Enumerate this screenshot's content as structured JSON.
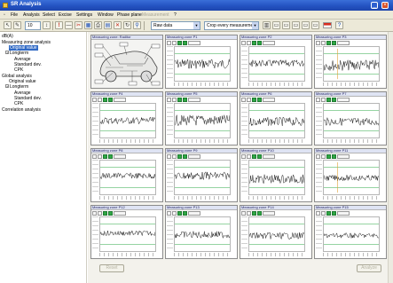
{
  "window": {
    "title": "SR Analysis"
  },
  "menu": {
    "items": [
      {
        "label": "File"
      },
      {
        "label": "Analysis"
      },
      {
        "label": "Select"
      },
      {
        "label": "Excise"
      },
      {
        "label": "Settings"
      },
      {
        "label": "Window"
      },
      {
        "label": "Phase plane"
      },
      {
        "label": "Measurement"
      },
      {
        "label": "?"
      }
    ]
  },
  "toolbar": {
    "field_value": "10",
    "data_combo": "Raw data",
    "mode_combo": "Crop every measurement"
  },
  "tree": {
    "root": "dB(A)",
    "items": [
      {
        "label": "Measuring zone analysis",
        "level": 0
      },
      {
        "label": "Original value",
        "level": 1,
        "selected": true
      },
      {
        "label": "Longterm",
        "level": 1,
        "expander": "+"
      },
      {
        "label": "Average",
        "level": 2
      },
      {
        "label": "Standard dev.",
        "level": 2
      },
      {
        "label": "CPK",
        "level": 2
      },
      {
        "label": "Global analysis",
        "level": 0
      },
      {
        "label": "Original value",
        "level": 1
      },
      {
        "label": "Longterm",
        "level": 1,
        "expander": "+"
      },
      {
        "label": "Average",
        "level": 2
      },
      {
        "label": "Standard dev.",
        "level": 2
      },
      {
        "label": "CPK",
        "level": 2
      },
      {
        "label": "Correlation analysis",
        "level": 0
      }
    ]
  },
  "panels": {
    "car_title": "Measuring zone: Raditor",
    "titles": [
      "Measuring zone P1",
      "Measuring zone P2",
      "Measuring zone P3",
      "Measuring zone P4",
      "Measuring zone P5",
      "Measuring zone P6",
      "Measuring zone P7",
      "Measuring zone P8",
      "Measuring zone P9",
      "Measuring zone P10",
      "Measuring zone P11",
      "Measuring zone P12",
      "Measuring zone P13",
      "Measuring zone P14",
      "Measuring zone P15"
    ]
  },
  "bottom": {
    "left_button": "Reset",
    "right_button": "Analyze"
  },
  "colors": {
    "accent": "#316ac5",
    "limit_line": "#2fa845",
    "trace": "#111111",
    "mark": "#e0a030"
  }
}
